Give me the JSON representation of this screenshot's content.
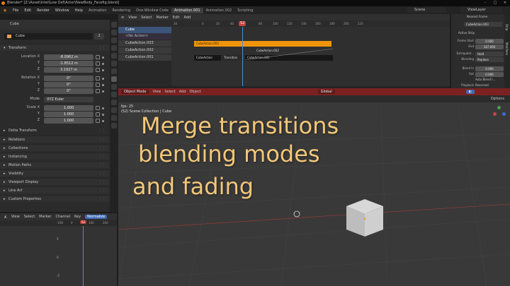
{
  "window": {
    "title": "Blender* [Z:\\Asset\\Intel\\Low Def\\Actor\\NewBody_Facefig.blend]",
    "controls": [
      "–",
      "□",
      "✕"
    ]
  },
  "menubar": {
    "items": [
      "File",
      "Edit",
      "Render",
      "Window",
      "Help"
    ],
    "workspaces": [
      "Animation",
      "Rendering",
      "One-Window Code",
      "Animation.001",
      "Animation.002",
      "Scripting"
    ],
    "active_workspace": "Animation.001",
    "scene": "Scene",
    "view_layer": "ViewLayer"
  },
  "properties": {
    "header_title": "Cube",
    "object_name": "Cube",
    "users": "2",
    "transform_label": "Transform",
    "location_label": "Location X",
    "location": [
      "-8.0962 m",
      "-1.8512 m",
      "3.1927 m"
    ],
    "rotation_label": "Rotation X",
    "rotation": [
      "0°",
      "0°",
      "0°"
    ],
    "axis_y": "Y",
    "axis_z": "Z",
    "mode_label": "Mode",
    "mode": "XYZ Euler",
    "scale_label": "Scale X",
    "scale": [
      "1.000",
      "1.000",
      "1.000"
    ],
    "delta_transform": "Delta Transform",
    "sections": [
      "Relations",
      "Collections",
      "Instancing",
      "Motion Paths",
      "Visibility",
      "Viewport Display",
      "Line Art",
      "Custom Properties"
    ]
  },
  "graph": {
    "menu": [
      "View",
      "Select",
      "Marker",
      "Channel",
      "Key"
    ],
    "mode_tag": "Normalize",
    "ruler": [
      "-100",
      "0",
      "100",
      "200"
    ],
    "current_frame": "52",
    "y_labels": [
      "5",
      "0",
      "-5"
    ]
  },
  "nla": {
    "menu": [
      "View",
      "Select",
      "Marker",
      "Edit",
      "Add"
    ],
    "ruler": [
      "20",
      "0",
      "20",
      "40",
      "60",
      "80",
      "100",
      "120",
      "140",
      "160",
      "180",
      "200",
      "220"
    ],
    "current_frame": "52",
    "tracks": [
      "Cube",
      "<No Action>",
      "CubeAction.003",
      "CubeAction.002",
      "CubeAction.001"
    ],
    "strips": {
      "active": "CubeAction.003",
      "mid": "CubeAction.002",
      "a": "CubeAction",
      "trans": "Transition",
      "b": "CubeAction.001"
    }
  },
  "sidebar": {
    "strip_name": "CubeAction.003",
    "active_strip": "Active Strip",
    "frame_start_label": "Frame Start",
    "frame_start": "0.000",
    "end_label": "End",
    "end": "147.000",
    "extrapolation_label": "Extrapolat...",
    "extrapolation": "Hold",
    "blending_label": "Blending",
    "blending": "Replace",
    "blend_in_label": "Blend In",
    "blend_in": "0.000",
    "out_label": "Out",
    "out": "0.000",
    "auto_blend": "Auto Blend I...",
    "playback_label": "Playback",
    "reversed": "Reversed",
    "nearest_frame": "Nearest Frame",
    "tabs": [
      "Strip",
      "Modifiers"
    ]
  },
  "viewport": {
    "mode": "Object Mode",
    "menu": [
      "View",
      "Select",
      "Add",
      "Object"
    ],
    "orientation": "Global",
    "options": "Options",
    "info_line1": "fps: 25",
    "info_line2": "(52) Scene Collection | Cube",
    "overlay_lines": [
      "Merge transitions",
      "blending modes",
      "and fading"
    ]
  },
  "colors": {
    "accent_orange": "#f0940b",
    "frame_red": "#c4403a",
    "viewport_header_red": "#7b2121",
    "overlay_text": "#f3c77a",
    "select_blue": "#3f6ab5"
  }
}
